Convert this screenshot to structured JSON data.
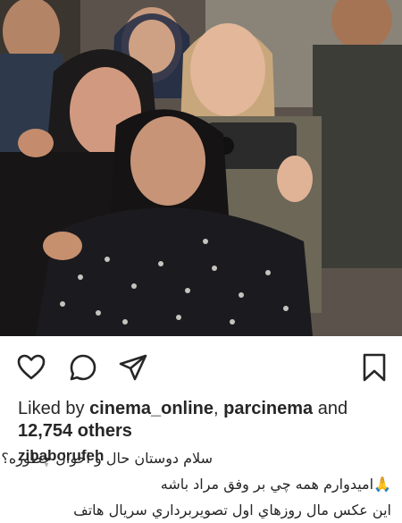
{
  "post": {
    "photo": {
      "alt_semantic": "group-selfie-photo"
    },
    "actions": {
      "like_icon": "heart-icon",
      "comment_icon": "comment-bubble-icon",
      "share_icon": "paper-plane-icon",
      "save_icon": "bookmark-icon"
    },
    "likes": {
      "prefix": "Liked by ",
      "user1": "cinema_online",
      "separator": ", ",
      "user2": "parcinema",
      "conjunction": " and",
      "others": "12,754 others"
    },
    "caption": {
      "username": "zibaborufeh",
      "line1": "سلام دوستان حال و احوال چطوره؟",
      "line2": "🙏اميدوارم همه چي بر وفق مراد باشه",
      "line3": "اين عكس مال روزهاي اول تصويربرداري سريال هاتف"
    }
  }
}
